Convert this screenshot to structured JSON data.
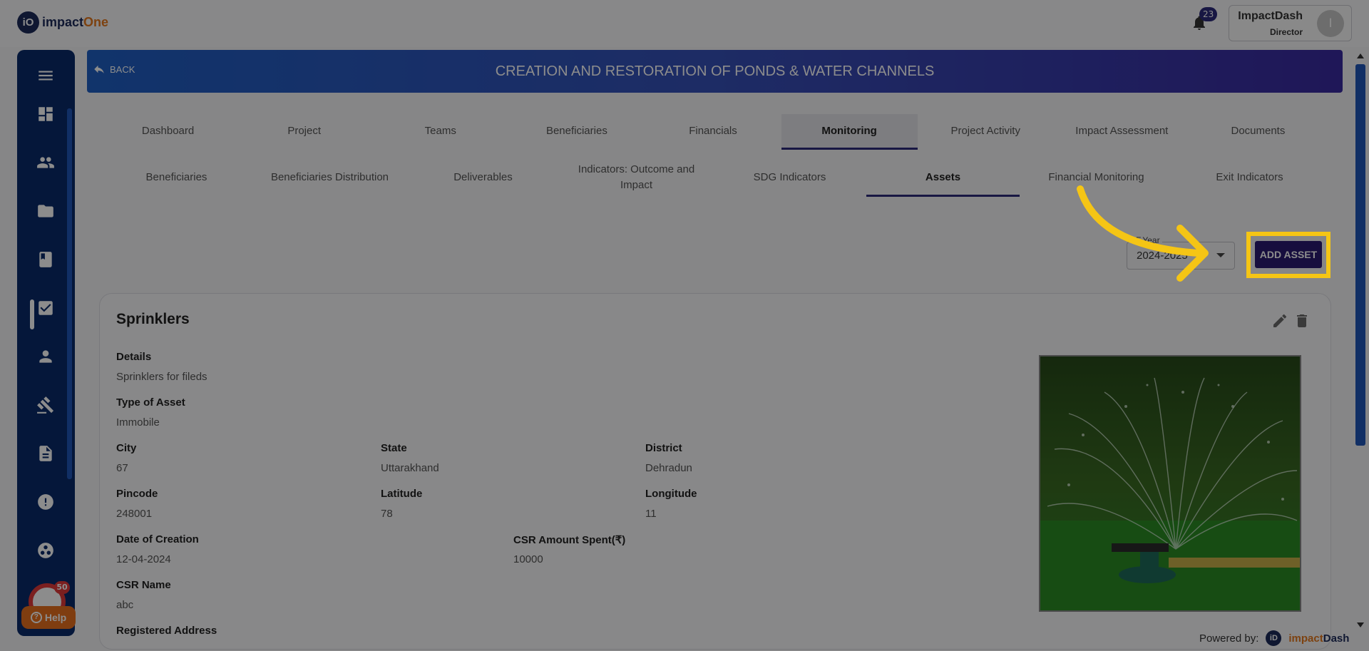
{
  "app": {
    "logo_mark": "iO",
    "logo_part1": "impact",
    "logo_part2": "One",
    "notification_count": "23",
    "user_name": "ImpactDash",
    "user_role": "Director",
    "user_initial": "I"
  },
  "sidebar": {
    "icons": [
      "menu-icon",
      "dashboard-icon",
      "people-icon",
      "folder-icon",
      "book-icon",
      "checkbox-icon",
      "person-icon",
      "gavel-icon",
      "document-icon",
      "alert-icon",
      "group-icon"
    ],
    "help_badge": "50",
    "help_label": "Help"
  },
  "banner": {
    "back_label": "BACK",
    "title": "CREATION AND RESTORATION OF PONDS & WATER CHANNELS"
  },
  "main_tabs": [
    {
      "label": "Dashboard"
    },
    {
      "label": "Project"
    },
    {
      "label": "Teams"
    },
    {
      "label": "Beneficiaries"
    },
    {
      "label": "Financials"
    },
    {
      "label": "Monitoring"
    },
    {
      "label": "Project Activity"
    },
    {
      "label": "Impact Assessment"
    },
    {
      "label": "Documents"
    }
  ],
  "sub_tabs": [
    {
      "label": "Beneficiaries"
    },
    {
      "label": "Beneficiaries Distribution"
    },
    {
      "label": "Deliverables"
    },
    {
      "label": "Indicators: Outcome and Impact"
    },
    {
      "label": "SDG Indicators"
    },
    {
      "label": "Assets"
    },
    {
      "label": "Financial Monitoring"
    },
    {
      "label": "Exit Indicators"
    }
  ],
  "toolbar": {
    "fyear_label": "F.Year",
    "fyear_value": "2024-2025",
    "add_asset_label": "ADD ASSET"
  },
  "asset": {
    "title": "Sprinklers",
    "details_label": "Details",
    "details_value": "Sprinklers for fileds",
    "type_label": "Type of Asset",
    "type_value": "Immobile",
    "city_label": "City",
    "city_value": "67",
    "state_label": "State",
    "state_value": "Uttarakhand",
    "district_label": "District",
    "district_value": "Dehradun",
    "pincode_label": "Pincode",
    "pincode_value": "248001",
    "latitude_label": "Latitude",
    "latitude_value": "78",
    "longitude_label": "Longitude",
    "longitude_value": "11",
    "date_label": "Date of Creation",
    "date_value": "12-04-2024",
    "csr_amount_label": "CSR Amount Spent(₹)",
    "csr_amount_value": "10000",
    "csr_name_label": "CSR Name",
    "csr_name_value": "abc",
    "registered_address_label": "Registered Address"
  },
  "footer": {
    "powered_by": "Powered by:",
    "brand_mark": "iD",
    "brand_part1": "impact",
    "brand_part2": "Dash"
  },
  "colors": {
    "brand_navy": "#1c2a5a",
    "brand_orange": "#e4781e",
    "sidebar_bg": "#0a2a6a",
    "accent_purple": "#2a1a72",
    "highlight_yellow": "#f5c515"
  }
}
